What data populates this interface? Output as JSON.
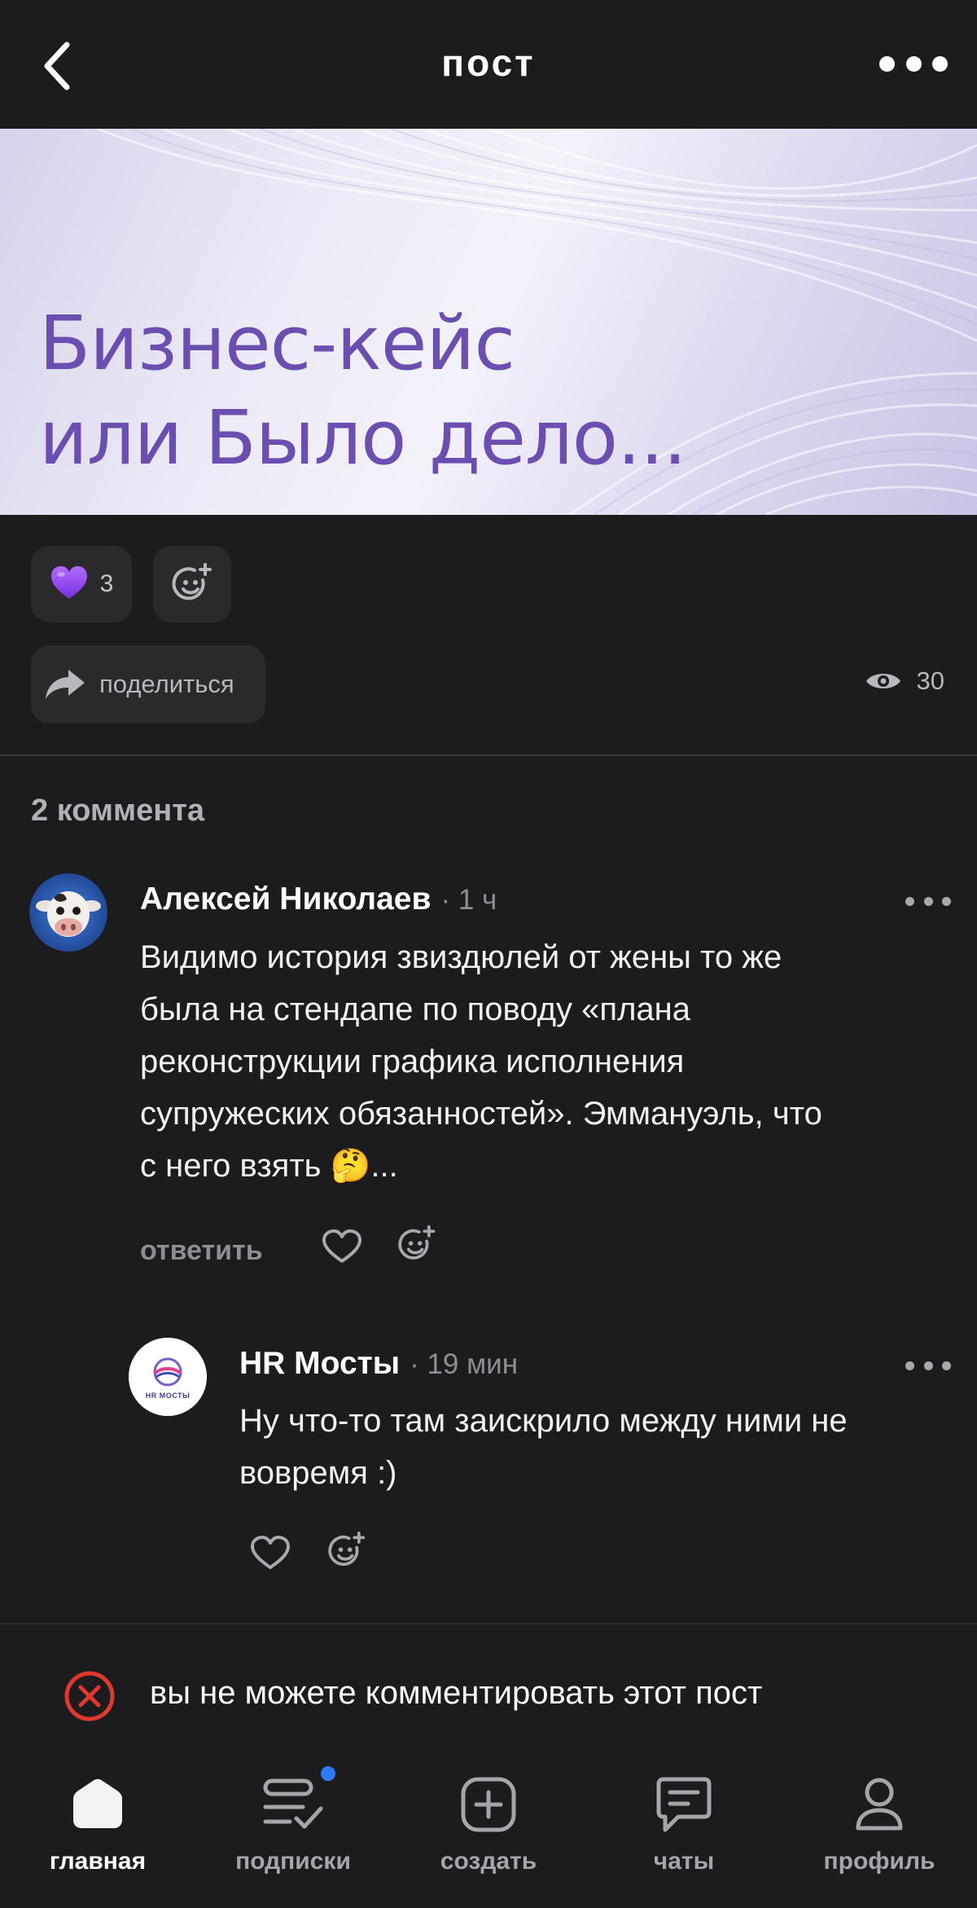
{
  "header": {
    "title": "пост",
    "back_icon": "chevron-left-icon",
    "more_icon": "more-horizontal-icon"
  },
  "banner": {
    "line1": "Бизнес-кейс",
    "line2": "или Было дело...",
    "text_color": "#6a4fb0"
  },
  "reactions": {
    "like_emoji": "💜",
    "like_count": "3",
    "add_reaction_icon": "add-emoji-icon"
  },
  "share": {
    "label": "поделиться",
    "icon": "share-arrow-icon"
  },
  "views": {
    "count": "30",
    "icon": "eye-icon"
  },
  "comments": {
    "count_label": "2 коммента",
    "items": [
      {
        "author": "Алексей Николаев",
        "time": "· 1 ч",
        "text_lines": [
          "Видимо история звиздюлей от жены то же",
          "была на стендапе по поводу «плана",
          "реконструкции графика исполнения",
          "супружеских обязанностей». Эммануэль, что",
          "с него взять 🤔..."
        ],
        "reply_label": "ответить"
      },
      {
        "author": "HR Мосты",
        "time": "· 19 мин",
        "avatar_text": "HR МОСТЫ",
        "text_lines": [
          "Ну что-то там заискрило между ними не",
          "вовремя :)"
        ]
      }
    ]
  },
  "notice": {
    "text": "вы не можете комментировать этот пост",
    "icon": "error-x-circle-icon",
    "icon_color": "#e0382e"
  },
  "bottom_nav": {
    "items": [
      {
        "label": "главная",
        "icon": "home-icon",
        "active": true
      },
      {
        "label": "подписки",
        "icon": "subscriptions-icon",
        "active": false,
        "has_badge": true
      },
      {
        "label": "создать",
        "icon": "plus-square-icon",
        "active": false
      },
      {
        "label": "чаты",
        "icon": "chat-icon",
        "active": false
      },
      {
        "label": "профиль",
        "icon": "profile-icon",
        "active": false
      }
    ],
    "badge_color": "#2f7cf6"
  }
}
